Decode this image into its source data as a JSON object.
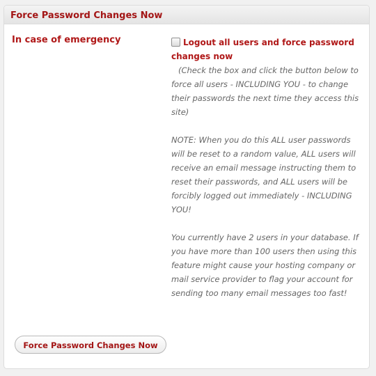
{
  "panel": {
    "title": "Force Password Changes Now"
  },
  "setting": {
    "label": "In case of emergency",
    "checkbox_label": "Logout all users and force password changes now",
    "checked": false,
    "description_1": "(Check the box and click the button below to force all users - INCLUDING YOU - to change their passwords the next time they access this site)",
    "description_2": "NOTE: When you do this ALL user passwords will be reset to a random value, ALL users will receive an email message instructing them to reset their passwords, and ALL users will be forcibly logged out immediately - INCLUDING YOU!",
    "description_3": "You currently have 2 users in your database. If you have more than 100 users then using this feature might cause your hosting company or mail service provider to flag your account for sending too many email messages too fast!"
  },
  "actions": {
    "submit_label": "Force Password Changes Now"
  },
  "colors": {
    "accent": "#a31515",
    "text_muted": "#666666",
    "background": "#f1f1f1"
  }
}
